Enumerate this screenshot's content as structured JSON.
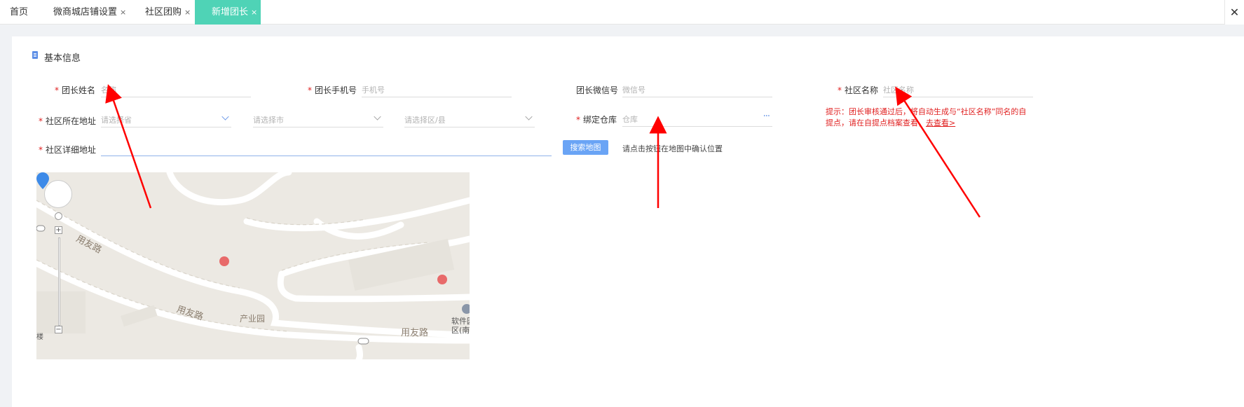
{
  "tabs": [
    {
      "label": "首页",
      "closable": false
    },
    {
      "label": "微商城店铺设置",
      "closable": true
    },
    {
      "label": "社区团购",
      "closable": true
    },
    {
      "label": "新增团长",
      "closable": true,
      "active": true
    }
  ],
  "tab_close_glyph": "×",
  "window_close_glyph": "✕",
  "section": {
    "title": "基本信息",
    "icon": "document-icon"
  },
  "required_mark": "*",
  "form": {
    "leader_name": {
      "label": "团长姓名",
      "placeholder": "名称"
    },
    "leader_phone": {
      "label": "团长手机号",
      "placeholder": "手机号"
    },
    "leader_wechat": {
      "label": "团长微信号",
      "placeholder": "微信号"
    },
    "community_name": {
      "label": "社区名称",
      "placeholder": "社区名称"
    },
    "community_address": {
      "label": "社区所在地址",
      "province_placeholder": "请选择省",
      "city_placeholder": "请选择市",
      "district_placeholder": "请选择区/县"
    },
    "warehouse": {
      "label": "绑定仓库",
      "placeholder": "仓库",
      "more": "···"
    },
    "detail_address": {
      "label": "社区详细地址",
      "value": ""
    }
  },
  "search_map_button": "搜索地图",
  "map_hint": "请点击按钮在地图中确认位置",
  "tip": {
    "text": "提示：团长审核通过后，将自动生成与“社区名称”同名的自提点，请在自提点档案查看，",
    "link": "去查看>"
  },
  "map": {
    "road_labels": [
      "用友路",
      "用友路",
      "用友路"
    ],
    "poi_label": "产业园",
    "poi_right": [
      "软件园",
      "区(南"
    ],
    "left_edge_label": "楼",
    "zoom_in": "+",
    "zoom_out": "−",
    "marker_color": "#3d8ae8"
  },
  "colors": {
    "active_tab": "#4fd3b6",
    "required": "#e02020",
    "primary_button": "#6aa4f5",
    "arrow": "#ff0000"
  }
}
